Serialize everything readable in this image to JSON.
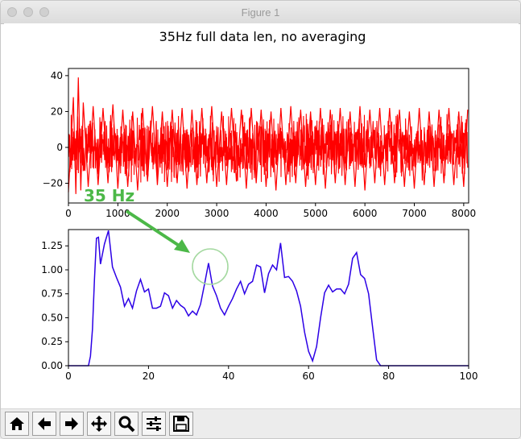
{
  "window": {
    "title": "Figure 1"
  },
  "figure": {
    "suptitle": "35Hz full data len, no averaging"
  },
  "annotation": {
    "text": "35 Hz",
    "color": "#4cb848"
  },
  "colors": {
    "time_series": "#ff0000",
    "spectrum": "#2c00e6",
    "annotation": "#4cb848"
  },
  "toolbar": [
    {
      "icon": "home-icon"
    },
    {
      "icon": "back-arrow-icon"
    },
    {
      "icon": "forward-arrow-icon"
    },
    {
      "icon": "move-icon"
    },
    {
      "icon": "zoom-icon"
    },
    {
      "icon": "sliders-icon"
    },
    {
      "icon": "save-icon"
    }
  ],
  "chart_data": [
    {
      "type": "line",
      "title": "",
      "xlabel": "",
      "ylabel": "",
      "xlim": [
        0,
        8100
      ],
      "ylim": [
        -31,
        44
      ],
      "xticks": [
        "0",
        "1000",
        "2000",
        "3000",
        "4000",
        "5000",
        "6000",
        "7000",
        "8000"
      ],
      "yticks": [
        "−20",
        "0",
        "20",
        "40"
      ],
      "series": [
        {
          "x": [
            0,
            100,
            150,
            200,
            250,
            300,
            400,
            500,
            600,
            700,
            800,
            900,
            1000,
            1100,
            1200,
            1300,
            1400,
            1500,
            1600,
            1700,
            1800,
            1900,
            2000,
            2100,
            2200,
            2300,
            2400,
            2500,
            2600,
            2700,
            2800,
            2900,
            3000,
            3100,
            3200,
            3300,
            3400,
            3500,
            3600,
            3700,
            3800,
            3900,
            4000,
            4100,
            4200,
            4300,
            4400,
            4500,
            4600,
            4700,
            4800,
            4900,
            5000,
            5100,
            5200,
            5300,
            5400,
            5500,
            5600,
            5700,
            5800,
            5900,
            6000,
            6100,
            6200,
            6300,
            6400,
            6500,
            6600,
            6700,
            6800,
            6900,
            7000,
            7100,
            7200,
            7300,
            7400,
            7500,
            7600,
            7700,
            7800,
            7900,
            8000,
            8080
          ],
          "y": [
            -25,
            28,
            -26,
            39,
            -24,
            25,
            -22,
            23,
            -21,
            22,
            -20,
            24,
            -23,
            21,
            -22,
            20,
            -24,
            22,
            -19,
            23,
            -21,
            20,
            -22,
            21,
            -20,
            22,
            -23,
            21,
            -21,
            22,
            -20,
            23,
            -22,
            20,
            -21,
            22,
            -19,
            21,
            -23,
            22,
            -20,
            21,
            -22,
            20,
            -24,
            22,
            -21,
            23,
            -20,
            21,
            -22,
            20,
            -21,
            22,
            -23,
            21,
            -20,
            22,
            -21,
            20,
            -22,
            23,
            -24,
            21,
            -20,
            22,
            -21,
            22,
            -20,
            21,
            -22,
            20,
            -23,
            22,
            -21,
            20,
            -22,
            21,
            -20,
            22,
            -21,
            20,
            -22,
            21
          ]
        }
      ]
    },
    {
      "type": "line",
      "title": "",
      "xlabel": "",
      "ylabel": "",
      "xlim": [
        0,
        100
      ],
      "ylim": [
        0,
        1.42
      ],
      "xticks": [
        "0",
        "20",
        "40",
        "60",
        "80",
        "100"
      ],
      "yticks": [
        "0.00",
        "0.25",
        "0.50",
        "0.75",
        "1.00",
        "1.25"
      ],
      "series": [
        {
          "x": [
            0,
            5,
            5.5,
            6,
            6.5,
            7,
            7.5,
            8,
            9,
            10,
            11,
            12,
            13,
            14,
            15,
            16,
            17,
            18,
            19,
            20,
            21,
            22,
            23,
            24,
            25,
            26,
            27,
            28,
            29,
            30,
            31,
            32,
            33,
            34,
            35,
            36,
            37,
            38,
            39,
            40,
            41,
            42,
            43,
            44,
            45,
            46,
            47,
            48,
            49,
            50,
            51,
            52,
            53,
            54,
            55,
            56,
            57,
            58,
            59,
            60,
            61,
            62,
            63,
            64,
            65,
            66,
            67,
            68,
            69,
            70,
            71,
            72,
            73,
            74,
            75,
            76,
            77,
            78,
            80,
            100
          ],
          "y": [
            0,
            0,
            0.1,
            0.38,
            0.9,
            1.33,
            1.34,
            1.06,
            1.27,
            1.41,
            1.03,
            0.92,
            0.82,
            0.62,
            0.7,
            0.6,
            0.78,
            0.9,
            0.77,
            0.8,
            0.6,
            0.6,
            0.62,
            0.76,
            0.73,
            0.6,
            0.68,
            0.63,
            0.6,
            0.52,
            0.57,
            0.53,
            0.64,
            0.85,
            1.07,
            0.83,
            0.73,
            0.6,
            0.53,
            0.62,
            0.7,
            0.8,
            0.88,
            0.75,
            0.85,
            0.88,
            1.05,
            1.03,
            0.76,
            0.96,
            1.05,
            1.0,
            1.28,
            0.92,
            0.93,
            0.88,
            0.78,
            0.62,
            0.35,
            0.15,
            0.05,
            0.2,
            0.5,
            0.76,
            0.84,
            0.77,
            0.8,
            0.8,
            0.75,
            0.85,
            1.12,
            1.18,
            0.95,
            0.91,
            0.75,
            0.4,
            0.06,
            0,
            0,
            0
          ]
        }
      ]
    }
  ]
}
